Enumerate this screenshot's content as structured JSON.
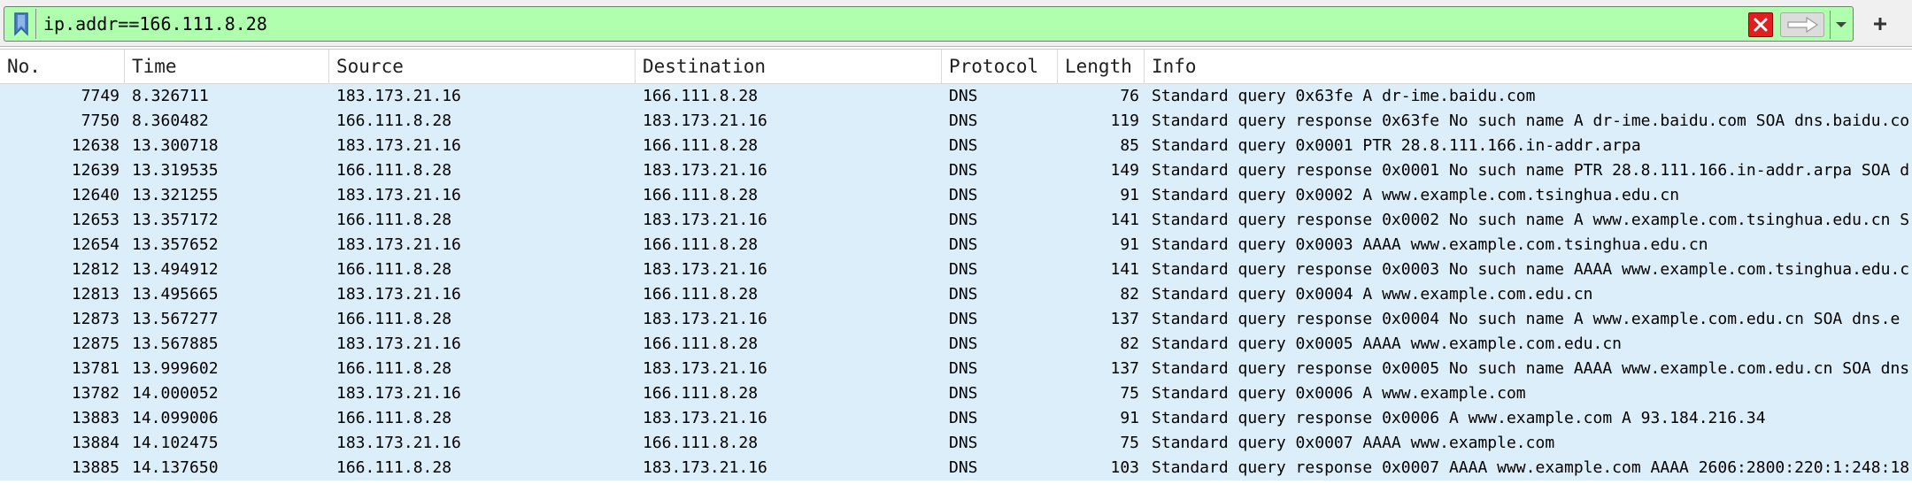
{
  "filter": {
    "value": "ip.addr==166.111.8.28",
    "add_label": "+"
  },
  "columns": [
    "No.",
    "Time",
    "Source",
    "Destination",
    "Protocol",
    "Length",
    "Info"
  ],
  "packets": [
    {
      "no": "7749",
      "time": "8.326711",
      "src": "183.173.21.16",
      "dst": "166.111.8.28",
      "proto": "DNS",
      "len": "76",
      "info": "Standard query 0x63fe A dr-ime.baidu.com"
    },
    {
      "no": "7750",
      "time": "8.360482",
      "src": "166.111.8.28",
      "dst": "183.173.21.16",
      "proto": "DNS",
      "len": "119",
      "info": "Standard query response 0x63fe No such name A dr-ime.baidu.com SOA dns.baidu.co"
    },
    {
      "no": "12638",
      "time": "13.300718",
      "src": "183.173.21.16",
      "dst": "166.111.8.28",
      "proto": "DNS",
      "len": "85",
      "info": "Standard query 0x0001 PTR 28.8.111.166.in-addr.arpa"
    },
    {
      "no": "12639",
      "time": "13.319535",
      "src": "166.111.8.28",
      "dst": "183.173.21.16",
      "proto": "DNS",
      "len": "149",
      "info": "Standard query response 0x0001 No such name PTR 28.8.111.166.in-addr.arpa SOA d"
    },
    {
      "no": "12640",
      "time": "13.321255",
      "src": "183.173.21.16",
      "dst": "166.111.8.28",
      "proto": "DNS",
      "len": "91",
      "info": "Standard query 0x0002 A www.example.com.tsinghua.edu.cn"
    },
    {
      "no": "12653",
      "time": "13.357172",
      "src": "166.111.8.28",
      "dst": "183.173.21.16",
      "proto": "DNS",
      "len": "141",
      "info": "Standard query response 0x0002 No such name A www.example.com.tsinghua.edu.cn S"
    },
    {
      "no": "12654",
      "time": "13.357652",
      "src": "183.173.21.16",
      "dst": "166.111.8.28",
      "proto": "DNS",
      "len": "91",
      "info": "Standard query 0x0003 AAAA www.example.com.tsinghua.edu.cn"
    },
    {
      "no": "12812",
      "time": "13.494912",
      "src": "166.111.8.28",
      "dst": "183.173.21.16",
      "proto": "DNS",
      "len": "141",
      "info": "Standard query response 0x0003 No such name AAAA www.example.com.tsinghua.edu.c"
    },
    {
      "no": "12813",
      "time": "13.495665",
      "src": "183.173.21.16",
      "dst": "166.111.8.28",
      "proto": "DNS",
      "len": "82",
      "info": "Standard query 0x0004 A www.example.com.edu.cn"
    },
    {
      "no": "12873",
      "time": "13.567277",
      "src": "166.111.8.28",
      "dst": "183.173.21.16",
      "proto": "DNS",
      "len": "137",
      "info": "Standard query response 0x0004 No such name A www.example.com.edu.cn SOA dns.e"
    },
    {
      "no": "12875",
      "time": "13.567885",
      "src": "183.173.21.16",
      "dst": "166.111.8.28",
      "proto": "DNS",
      "len": "82",
      "info": "Standard query 0x0005 AAAA www.example.com.edu.cn"
    },
    {
      "no": "13781",
      "time": "13.999602",
      "src": "166.111.8.28",
      "dst": "183.173.21.16",
      "proto": "DNS",
      "len": "137",
      "info": "Standard query response 0x0005 No such name AAAA www.example.com.edu.cn SOA dns"
    },
    {
      "no": "13782",
      "time": "14.000052",
      "src": "183.173.21.16",
      "dst": "166.111.8.28",
      "proto": "DNS",
      "len": "75",
      "info": "Standard query 0x0006 A www.example.com"
    },
    {
      "no": "13883",
      "time": "14.099006",
      "src": "166.111.8.28",
      "dst": "183.173.21.16",
      "proto": "DNS",
      "len": "91",
      "info": "Standard query response 0x0006 A www.example.com A 93.184.216.34"
    },
    {
      "no": "13884",
      "time": "14.102475",
      "src": "183.173.21.16",
      "dst": "166.111.8.28",
      "proto": "DNS",
      "len": "75",
      "info": "Standard query 0x0007 AAAA www.example.com"
    },
    {
      "no": "13885",
      "time": "14.137650",
      "src": "166.111.8.28",
      "dst": "183.173.21.16",
      "proto": "DNS",
      "len": "103",
      "info": "Standard query response 0x0007 AAAA www.example.com AAAA 2606:2800:220:1:248:18"
    }
  ],
  "colors": {
    "filter_valid_bg": "#afffaf",
    "row_bg": "#dceefa",
    "clear_button": "#e02020"
  },
  "icons": {
    "bookmark": "bookmark-icon",
    "clear": "close-icon",
    "apply": "arrow-right-icon",
    "history": "chevron-down-icon",
    "add": "plus-icon"
  }
}
